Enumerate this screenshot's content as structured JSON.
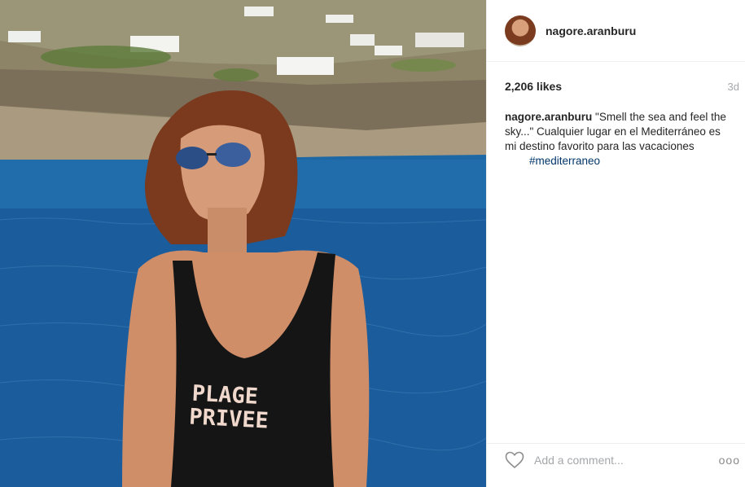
{
  "post": {
    "username": "nagore.aranburu",
    "likes": "2,206 likes",
    "time": "3d",
    "caption_text": "\"Smell the sea and feel the sky...\" Cualquier lugar en el Mediterráneo es mi destino favorito para las vacaciones",
    "hashtag": "#mediterraneo",
    "comment_placeholder": "Add a comment...",
    "more_label": "ooo",
    "swimsuit_print": [
      "PLAGE",
      "PRIVEE"
    ]
  },
  "icons": {
    "like": "heart-outline-icon",
    "more": "more-options-icon"
  },
  "colors": {
    "text": "#262626",
    "secondary": "#a5a7aa",
    "hashtag": "#003569",
    "divider": "#efefef"
  }
}
